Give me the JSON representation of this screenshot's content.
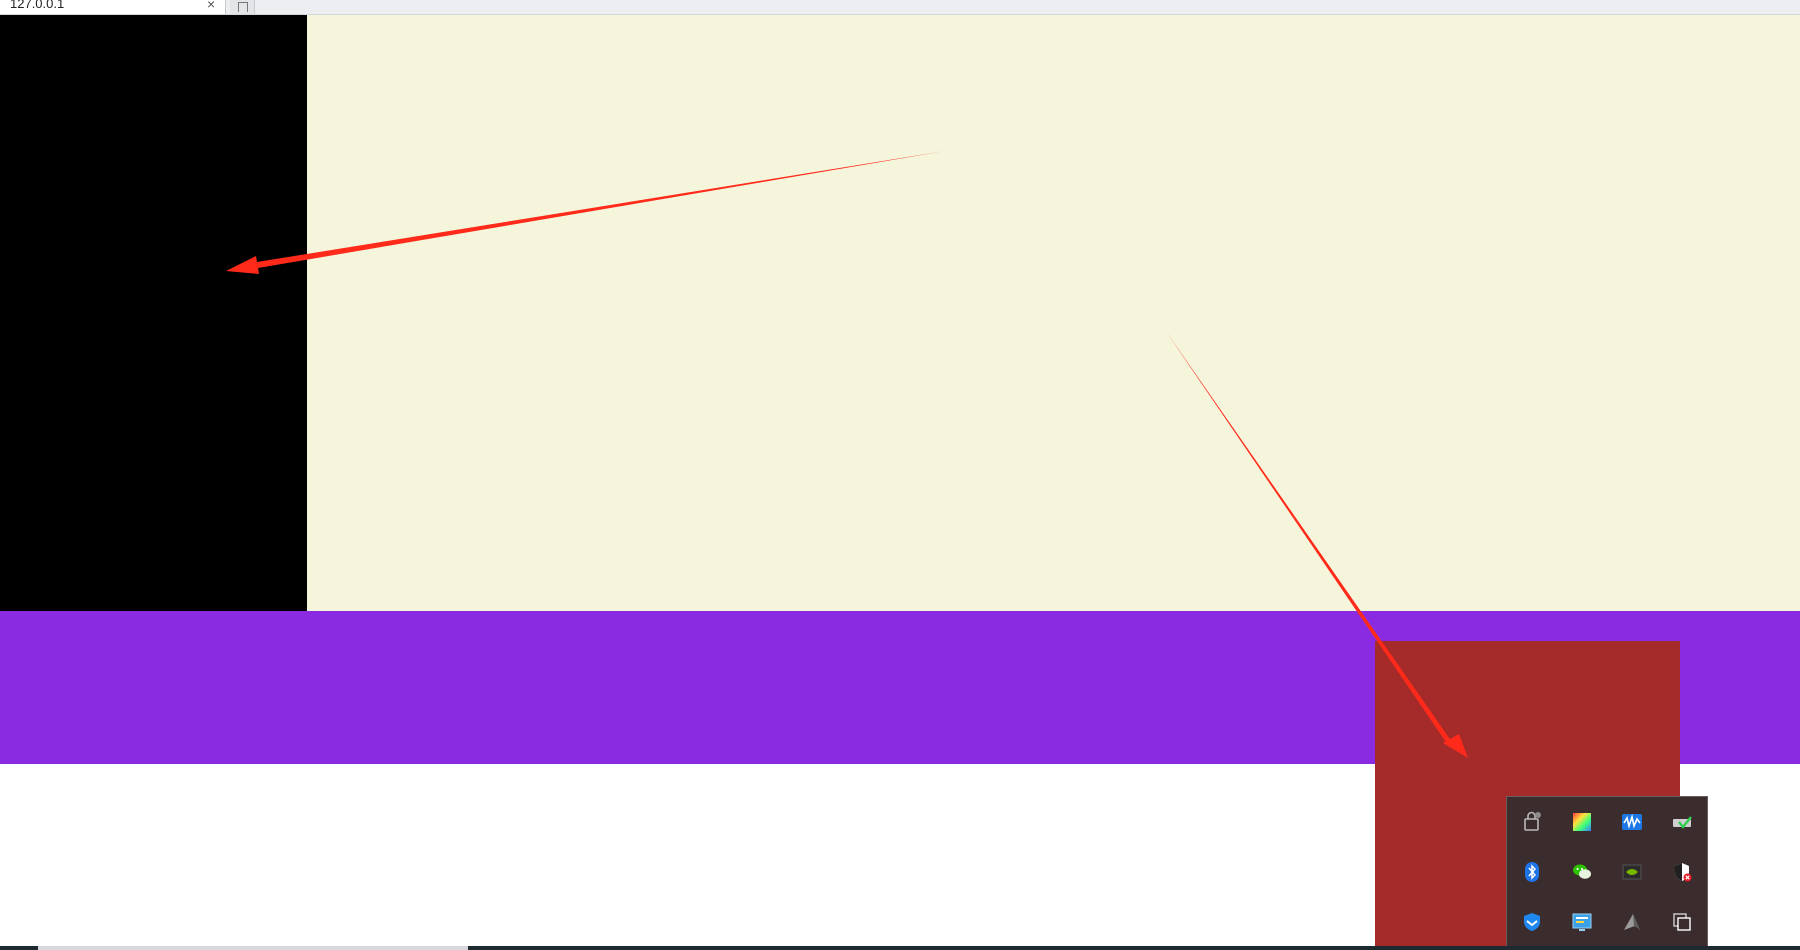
{
  "browser": {
    "tab_title": "127.0.0.1",
    "tab_close_glyph": "×"
  },
  "colors": {
    "cream_box": "#f5f5dc",
    "black_box": "#000000",
    "purple_box": "#8a2be2",
    "brown_box": "#a52a2a",
    "arrow": "#ff2a1a",
    "tray_background": "#3b2c2d"
  },
  "annotations": [
    {
      "name": "arrow-to-black-box",
      "icon": "red-arrow"
    },
    {
      "name": "arrow-to-brown-box",
      "icon": "red-arrow"
    }
  ],
  "tray": {
    "icons": [
      "lock-app-icon",
      "color-picker-icon",
      "audio-waveform-icon",
      "drive-check-icon",
      "bluetooth-icon",
      "wechat-icon",
      "nvidia-icon",
      "security-shield-icon",
      "shield-guard-icon",
      "monitor-app-icon",
      "shark-app-icon",
      "overlap-windows-icon"
    ]
  }
}
